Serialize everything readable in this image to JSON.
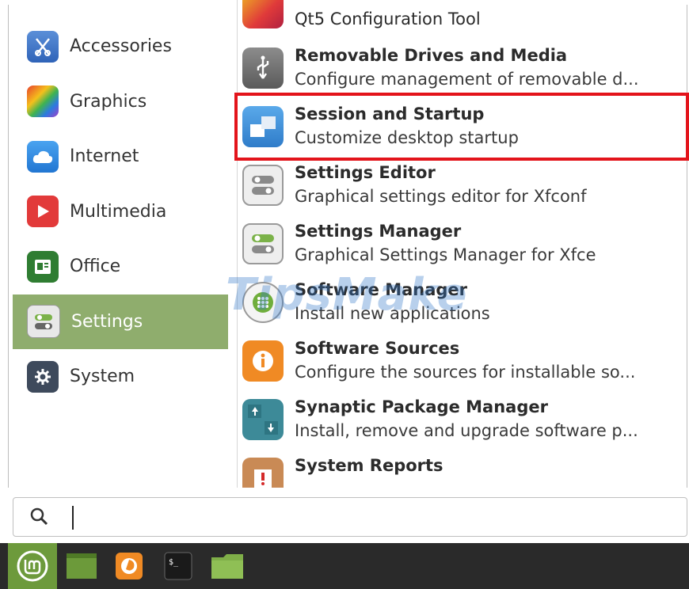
{
  "categories": [
    {
      "label": "Accessories",
      "icon": "accessories-icon",
      "active": false
    },
    {
      "label": "Graphics",
      "icon": "graphics-icon",
      "active": false
    },
    {
      "label": "Internet",
      "icon": "internet-icon",
      "active": false
    },
    {
      "label": "Multimedia",
      "icon": "multimedia-icon",
      "active": false
    },
    {
      "label": "Office",
      "icon": "office-icon",
      "active": false
    },
    {
      "label": "Settings",
      "icon": "settings-icon",
      "active": true
    },
    {
      "label": "System",
      "icon": "system-icon",
      "active": false
    }
  ],
  "apps": [
    {
      "name": "Qt5 Configuration Tool",
      "description": "",
      "icon": "qt5-config-icon"
    },
    {
      "name": "Removable Drives and Media",
      "description": "Configure management of removable d...",
      "icon": "usb-drive-icon"
    },
    {
      "name": "Session and Startup",
      "description": "Customize desktop startup",
      "icon": "session-startup-icon"
    },
    {
      "name": "Settings Editor",
      "description": "Graphical settings editor for Xfconf",
      "icon": "settings-editor-icon"
    },
    {
      "name": "Settings Manager",
      "description": "Graphical Settings Manager for Xfce",
      "icon": "settings-manager-icon"
    },
    {
      "name": "Software Manager",
      "description": "Install new applications",
      "icon": "software-manager-icon"
    },
    {
      "name": "Software Sources",
      "description": "Configure the sources for installable so...",
      "icon": "software-sources-icon"
    },
    {
      "name": "Synaptic Package Manager",
      "description": "Install, remove and upgrade software p...",
      "icon": "synaptic-icon"
    },
    {
      "name": "System Reports",
      "description": "",
      "icon": "system-reports-icon"
    }
  ],
  "watermark": "TipsMake",
  "search": {
    "value": "",
    "placeholder": ""
  },
  "colors": {
    "active_category": "#8fad6d",
    "highlight_border": "#e3141b",
    "panel": "#2a2a2a",
    "start_button": "#6d9a3c"
  }
}
